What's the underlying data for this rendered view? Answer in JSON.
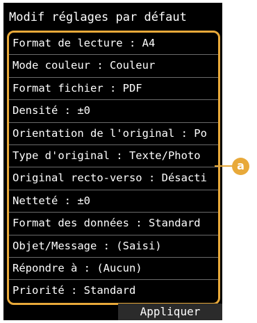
{
  "screen": {
    "title": "Modif réglages par défaut",
    "settings": [
      {
        "label": "Format de lecture : A4"
      },
      {
        "label": "Mode couleur : Couleur"
      },
      {
        "label": "Format fichier : PDF"
      },
      {
        "label": "Densité : ±0"
      },
      {
        "label": "Orientation de l'original : Po"
      },
      {
        "label": "Type d'original : Texte/Photo"
      },
      {
        "label": "Original recto-verso : Désacti"
      },
      {
        "label": "Netteté : ±0"
      },
      {
        "label": "Format des données : Standard"
      },
      {
        "label": "Objet/Message : (Saisi)"
      },
      {
        "label": "Répondre à : (Aucun)"
      },
      {
        "label": "Priorité : Standard"
      }
    ],
    "apply_label": "Appliquer"
  },
  "callout": {
    "label": "a"
  },
  "colors": {
    "highlight": "#e8a93a",
    "background": "#000000",
    "text": "#ffffff"
  }
}
